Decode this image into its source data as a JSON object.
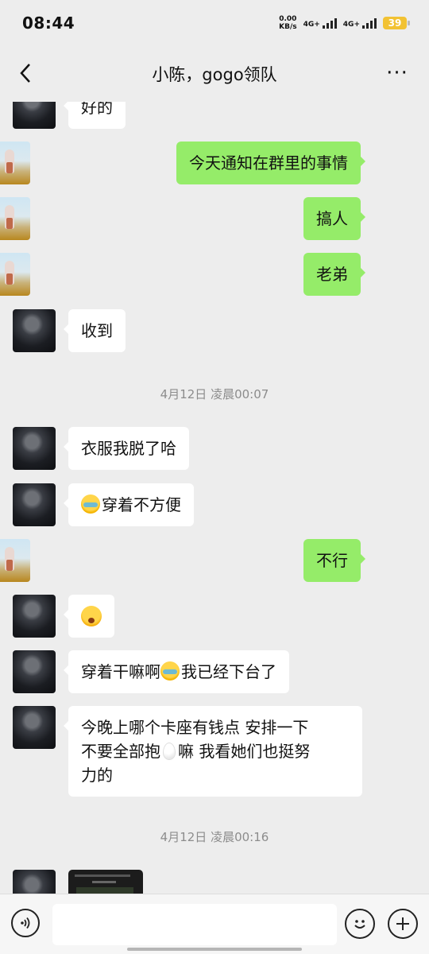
{
  "status": {
    "time": "08:44",
    "speed_value": "0.00",
    "speed_unit": "KB/s",
    "net1": "4G+",
    "net2": "4G+",
    "battery": "39"
  },
  "header": {
    "title": "小陈，gogo领队",
    "back_icon": "chevron-left-icon",
    "more_icon": "more-icon",
    "more_label": "···"
  },
  "messages": [
    {
      "side": "left",
      "text": "好的"
    },
    {
      "side": "right",
      "text": "今天通知在群里的事情"
    },
    {
      "side": "right",
      "text": "搞人"
    },
    {
      "side": "right",
      "text": "老弟"
    },
    {
      "side": "left",
      "text": "收到"
    },
    {
      "type": "time",
      "text": "4月12日 凌晨00:07"
    },
    {
      "side": "left",
      "text": "衣服我脱了哈"
    },
    {
      "side": "left",
      "emoji": "crying-laughing-emoji",
      "text": "穿着不方便"
    },
    {
      "side": "right",
      "text": "不行"
    },
    {
      "side": "left",
      "emoji": "surprised-face-emoji",
      "text": ""
    },
    {
      "side": "left",
      "text_a": "穿着干嘛啊",
      "emoji": "crying-laughing-emoji",
      "text_b": "我已经下台了"
    },
    {
      "side": "left",
      "line1": "今晚上哪个卡座有钱点 安排一下",
      "line2a": "不要全部抱",
      "emoji": "egg-emoji",
      "line2b": "嘛 我看她们也挺努",
      "line3": "力的"
    },
    {
      "type": "time",
      "text": "4月12日 凌晨00:16"
    },
    {
      "side": "left",
      "type": "image"
    }
  ],
  "inputbar": {
    "voice_icon": "voice-icon",
    "emoji_icon": "emoji-icon",
    "plus_icon": "plus-icon",
    "input_value": ""
  }
}
